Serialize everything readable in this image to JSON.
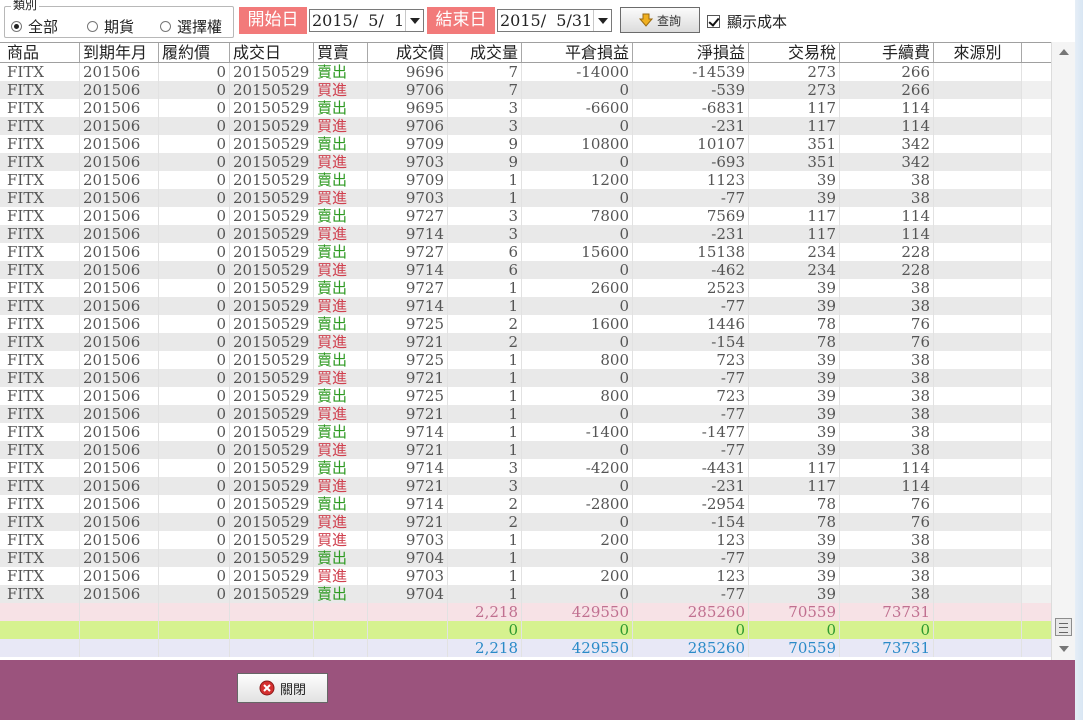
{
  "filter": {
    "type_group_title": "類別",
    "radios": [
      {
        "label": "全部",
        "selected": true
      },
      {
        "label": "期貨",
        "selected": false
      },
      {
        "label": "選擇權",
        "selected": false
      }
    ],
    "start_label": "開始日",
    "start_value": "2015/  5/  1",
    "end_label": "結束日",
    "end_value": "2015/  5/31",
    "query_label": "查詢",
    "show_cost_label": "顯示成本",
    "show_cost_checked": true
  },
  "table": {
    "headers": [
      "商品",
      "到期年月",
      "履約價",
      "成交日",
      "買賣",
      "成交價",
      "成交量",
      "平倉損益",
      "淨損益",
      "交易稅",
      "手續費",
      "來源別"
    ],
    "rows": [
      [
        "FITX",
        "201506",
        "0",
        "20150529",
        "賣出",
        "9696",
        "7",
        "-14000",
        "-14539",
        "273",
        "266",
        ""
      ],
      [
        "FITX",
        "201506",
        "0",
        "20150529",
        "買進",
        "9706",
        "7",
        "0",
        "-539",
        "273",
        "266",
        ""
      ],
      [
        "FITX",
        "201506",
        "0",
        "20150529",
        "賣出",
        "9695",
        "3",
        "-6600",
        "-6831",
        "117",
        "114",
        ""
      ],
      [
        "FITX",
        "201506",
        "0",
        "20150529",
        "買進",
        "9706",
        "3",
        "0",
        "-231",
        "117",
        "114",
        ""
      ],
      [
        "FITX",
        "201506",
        "0",
        "20150529",
        "賣出",
        "9709",
        "9",
        "10800",
        "10107",
        "351",
        "342",
        ""
      ],
      [
        "FITX",
        "201506",
        "0",
        "20150529",
        "買進",
        "9703",
        "9",
        "0",
        "-693",
        "351",
        "342",
        ""
      ],
      [
        "FITX",
        "201506",
        "0",
        "20150529",
        "賣出",
        "9709",
        "1",
        "1200",
        "1123",
        "39",
        "38",
        ""
      ],
      [
        "FITX",
        "201506",
        "0",
        "20150529",
        "買進",
        "9703",
        "1",
        "0",
        "-77",
        "39",
        "38",
        ""
      ],
      [
        "FITX",
        "201506",
        "0",
        "20150529",
        "賣出",
        "9727",
        "3",
        "7800",
        "7569",
        "117",
        "114",
        ""
      ],
      [
        "FITX",
        "201506",
        "0",
        "20150529",
        "買進",
        "9714",
        "3",
        "0",
        "-231",
        "117",
        "114",
        ""
      ],
      [
        "FITX",
        "201506",
        "0",
        "20150529",
        "賣出",
        "9727",
        "6",
        "15600",
        "15138",
        "234",
        "228",
        ""
      ],
      [
        "FITX",
        "201506",
        "0",
        "20150529",
        "買進",
        "9714",
        "6",
        "0",
        "-462",
        "234",
        "228",
        ""
      ],
      [
        "FITX",
        "201506",
        "0",
        "20150529",
        "賣出",
        "9727",
        "1",
        "2600",
        "2523",
        "39",
        "38",
        ""
      ],
      [
        "FITX",
        "201506",
        "0",
        "20150529",
        "買進",
        "9714",
        "1",
        "0",
        "-77",
        "39",
        "38",
        ""
      ],
      [
        "FITX",
        "201506",
        "0",
        "20150529",
        "賣出",
        "9725",
        "2",
        "1600",
        "1446",
        "78",
        "76",
        ""
      ],
      [
        "FITX",
        "201506",
        "0",
        "20150529",
        "買進",
        "9721",
        "2",
        "0",
        "-154",
        "78",
        "76",
        ""
      ],
      [
        "FITX",
        "201506",
        "0",
        "20150529",
        "賣出",
        "9725",
        "1",
        "800",
        "723",
        "39",
        "38",
        ""
      ],
      [
        "FITX",
        "201506",
        "0",
        "20150529",
        "買進",
        "9721",
        "1",
        "0",
        "-77",
        "39",
        "38",
        ""
      ],
      [
        "FITX",
        "201506",
        "0",
        "20150529",
        "賣出",
        "9725",
        "1",
        "800",
        "723",
        "39",
        "38",
        ""
      ],
      [
        "FITX",
        "201506",
        "0",
        "20150529",
        "買進",
        "9721",
        "1",
        "0",
        "-77",
        "39",
        "38",
        ""
      ],
      [
        "FITX",
        "201506",
        "0",
        "20150529",
        "賣出",
        "9714",
        "1",
        "-1400",
        "-1477",
        "39",
        "38",
        ""
      ],
      [
        "FITX",
        "201506",
        "0",
        "20150529",
        "買進",
        "9721",
        "1",
        "0",
        "-77",
        "39",
        "38",
        ""
      ],
      [
        "FITX",
        "201506",
        "0",
        "20150529",
        "賣出",
        "9714",
        "3",
        "-4200",
        "-4431",
        "117",
        "114",
        ""
      ],
      [
        "FITX",
        "201506",
        "0",
        "20150529",
        "買進",
        "9721",
        "3",
        "0",
        "-231",
        "117",
        "114",
        ""
      ],
      [
        "FITX",
        "201506",
        "0",
        "20150529",
        "賣出",
        "9714",
        "2",
        "-2800",
        "-2954",
        "78",
        "76",
        ""
      ],
      [
        "FITX",
        "201506",
        "0",
        "20150529",
        "買進",
        "9721",
        "2",
        "0",
        "-154",
        "78",
        "76",
        ""
      ],
      [
        "FITX",
        "201506",
        "0",
        "20150529",
        "買進",
        "9703",
        "1",
        "200",
        "123",
        "39",
        "38",
        ""
      ],
      [
        "FITX",
        "201506",
        "0",
        "20150529",
        "賣出",
        "9704",
        "1",
        "0",
        "-77",
        "39",
        "38",
        ""
      ],
      [
        "FITX",
        "201506",
        "0",
        "20150529",
        "買進",
        "9703",
        "1",
        "200",
        "123",
        "39",
        "38",
        ""
      ],
      [
        "FITX",
        "201506",
        "0",
        "20150529",
        "賣出",
        "9704",
        "1",
        "0",
        "-77",
        "39",
        "38",
        ""
      ]
    ],
    "summary": [
      {
        "values": [
          "2,218",
          "429550",
          "285260",
          "70559",
          "73731"
        ]
      },
      {
        "values": [
          "0",
          "0",
          "0",
          "0",
          "0"
        ]
      },
      {
        "values": [
          "2,218",
          "429550",
          "285260",
          "70559",
          "73731"
        ]
      }
    ]
  },
  "footer": {
    "close_label": "關閉"
  },
  "colors": {
    "sell": "#2e9a22",
    "buy": "#d0414f",
    "date_tag": "#f27a7a",
    "footer": "#9b537d",
    "summary_pink": "#f7e2e6",
    "summary_green": "#d6f28f",
    "summary_blue": "#e8e8f6"
  }
}
